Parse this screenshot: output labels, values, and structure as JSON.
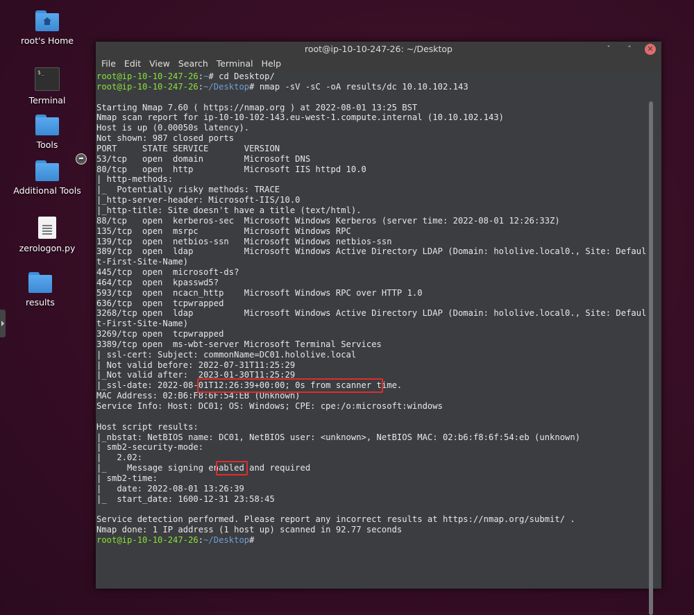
{
  "desktop": {
    "icons": [
      {
        "label": "root's Home",
        "icon": "home-folder-icon"
      },
      {
        "label": "Terminal",
        "icon": "terminal-icon"
      },
      {
        "label": "Tools",
        "icon": "folder-icon"
      },
      {
        "label": "Additional Tools",
        "icon": "folder-link-icon"
      },
      {
        "label": "zerologon.py",
        "icon": "text-file-icon"
      },
      {
        "label": "results",
        "icon": "folder-icon"
      }
    ]
  },
  "window": {
    "title": "root@ip-10-10-247-26: ~/Desktop",
    "buttons": {
      "minimize": "ˇ",
      "maximize": "˄",
      "close": "✕"
    },
    "menu": [
      "File",
      "Edit",
      "View",
      "Search",
      "Terminal",
      "Help"
    ]
  },
  "terminal": {
    "prompt_user": "root@ip-10-10-247-26",
    "prompt1_path": "~",
    "prompt1_cmd": "# cd Desktop/",
    "prompt2_path": "~/Desktop",
    "prompt2_cmd": "# nmap -sV -sC -oA results/dc 10.10.102.143",
    "final_path": "~/Desktop",
    "final_cmd": "#",
    "output": [
      "",
      "Starting Nmap 7.60 ( https://nmap.org ) at 2022-08-01 13:25 BST",
      "Nmap scan report for ip-10-10-102-143.eu-west-1.compute.internal (10.10.102.143)",
      "Host is up (0.00050s latency).",
      "Not shown: 987 closed ports",
      "PORT     STATE SERVICE       VERSION",
      "53/tcp   open  domain        Microsoft DNS",
      "80/tcp   open  http          Microsoft IIS httpd 10.0",
      "| http-methods:",
      "|_  Potentially risky methods: TRACE",
      "|_http-server-header: Microsoft-IIS/10.0",
      "|_http-title: Site doesn't have a title (text/html).",
      "88/tcp   open  kerberos-sec  Microsoft Windows Kerberos (server time: 2022-08-01 12:26:33Z)",
      "135/tcp  open  msrpc         Microsoft Windows RPC",
      "139/tcp  open  netbios-ssn   Microsoft Windows netbios-ssn",
      "389/tcp  open  ldap          Microsoft Windows Active Directory LDAP (Domain: hololive.local0., Site: Defaul",
      "t-First-Site-Name)",
      "445/tcp  open  microsoft-ds?",
      "464/tcp  open  kpasswd5?",
      "593/tcp  open  ncacn_http    Microsoft Windows RPC over HTTP 1.0",
      "636/tcp  open  tcpwrapped",
      "3268/tcp open  ldap          Microsoft Windows Active Directory LDAP (Domain: hololive.local0., Site: Defaul",
      "t-First-Site-Name)",
      "3269/tcp open  tcpwrapped",
      "3389/tcp open  ms-wbt-server Microsoft Terminal Services",
      "| ssl-cert: Subject: commonName=DC01.hololive.local",
      "| Not valid before: 2022-07-31T11:25:29",
      "|_Not valid after:  2023-01-30T11:25:29",
      "|_ssl-date: 2022-08-01T12:26:39+00:00; 0s from scanner time.",
      "MAC Address: 02:B6:F8:6F:54:EB (Unknown)",
      "Service Info: Host: DC01; OS: Windows; CPE: cpe:/o:microsoft:windows",
      "",
      "Host script results:",
      "|_nbstat: NetBIOS name: DC01, NetBIOS user: <unknown>, NetBIOS MAC: 02:b6:f8:6f:54:eb (unknown)",
      "| smb2-security-mode:",
      "|   2.02:",
      "|_    Message signing enabled and required",
      "| smb2-time:",
      "|   date: 2022-08-01 13:26:39",
      "|_  start_date: 1600-12-31 23:58:45",
      "",
      "Service detection performed. Please report any incorrect results at https://nmap.org/submit/ .",
      "Nmap done: 1 IP address (1 host up) scanned in 92.77 seconds"
    ],
    "highlights": [
      "commonName=DC01.hololive.local",
      "DC01"
    ]
  },
  "colors": {
    "prompt_user": "#8ae234",
    "prompt_path": "#729fcf",
    "highlight_box": "#e02d2d"
  }
}
